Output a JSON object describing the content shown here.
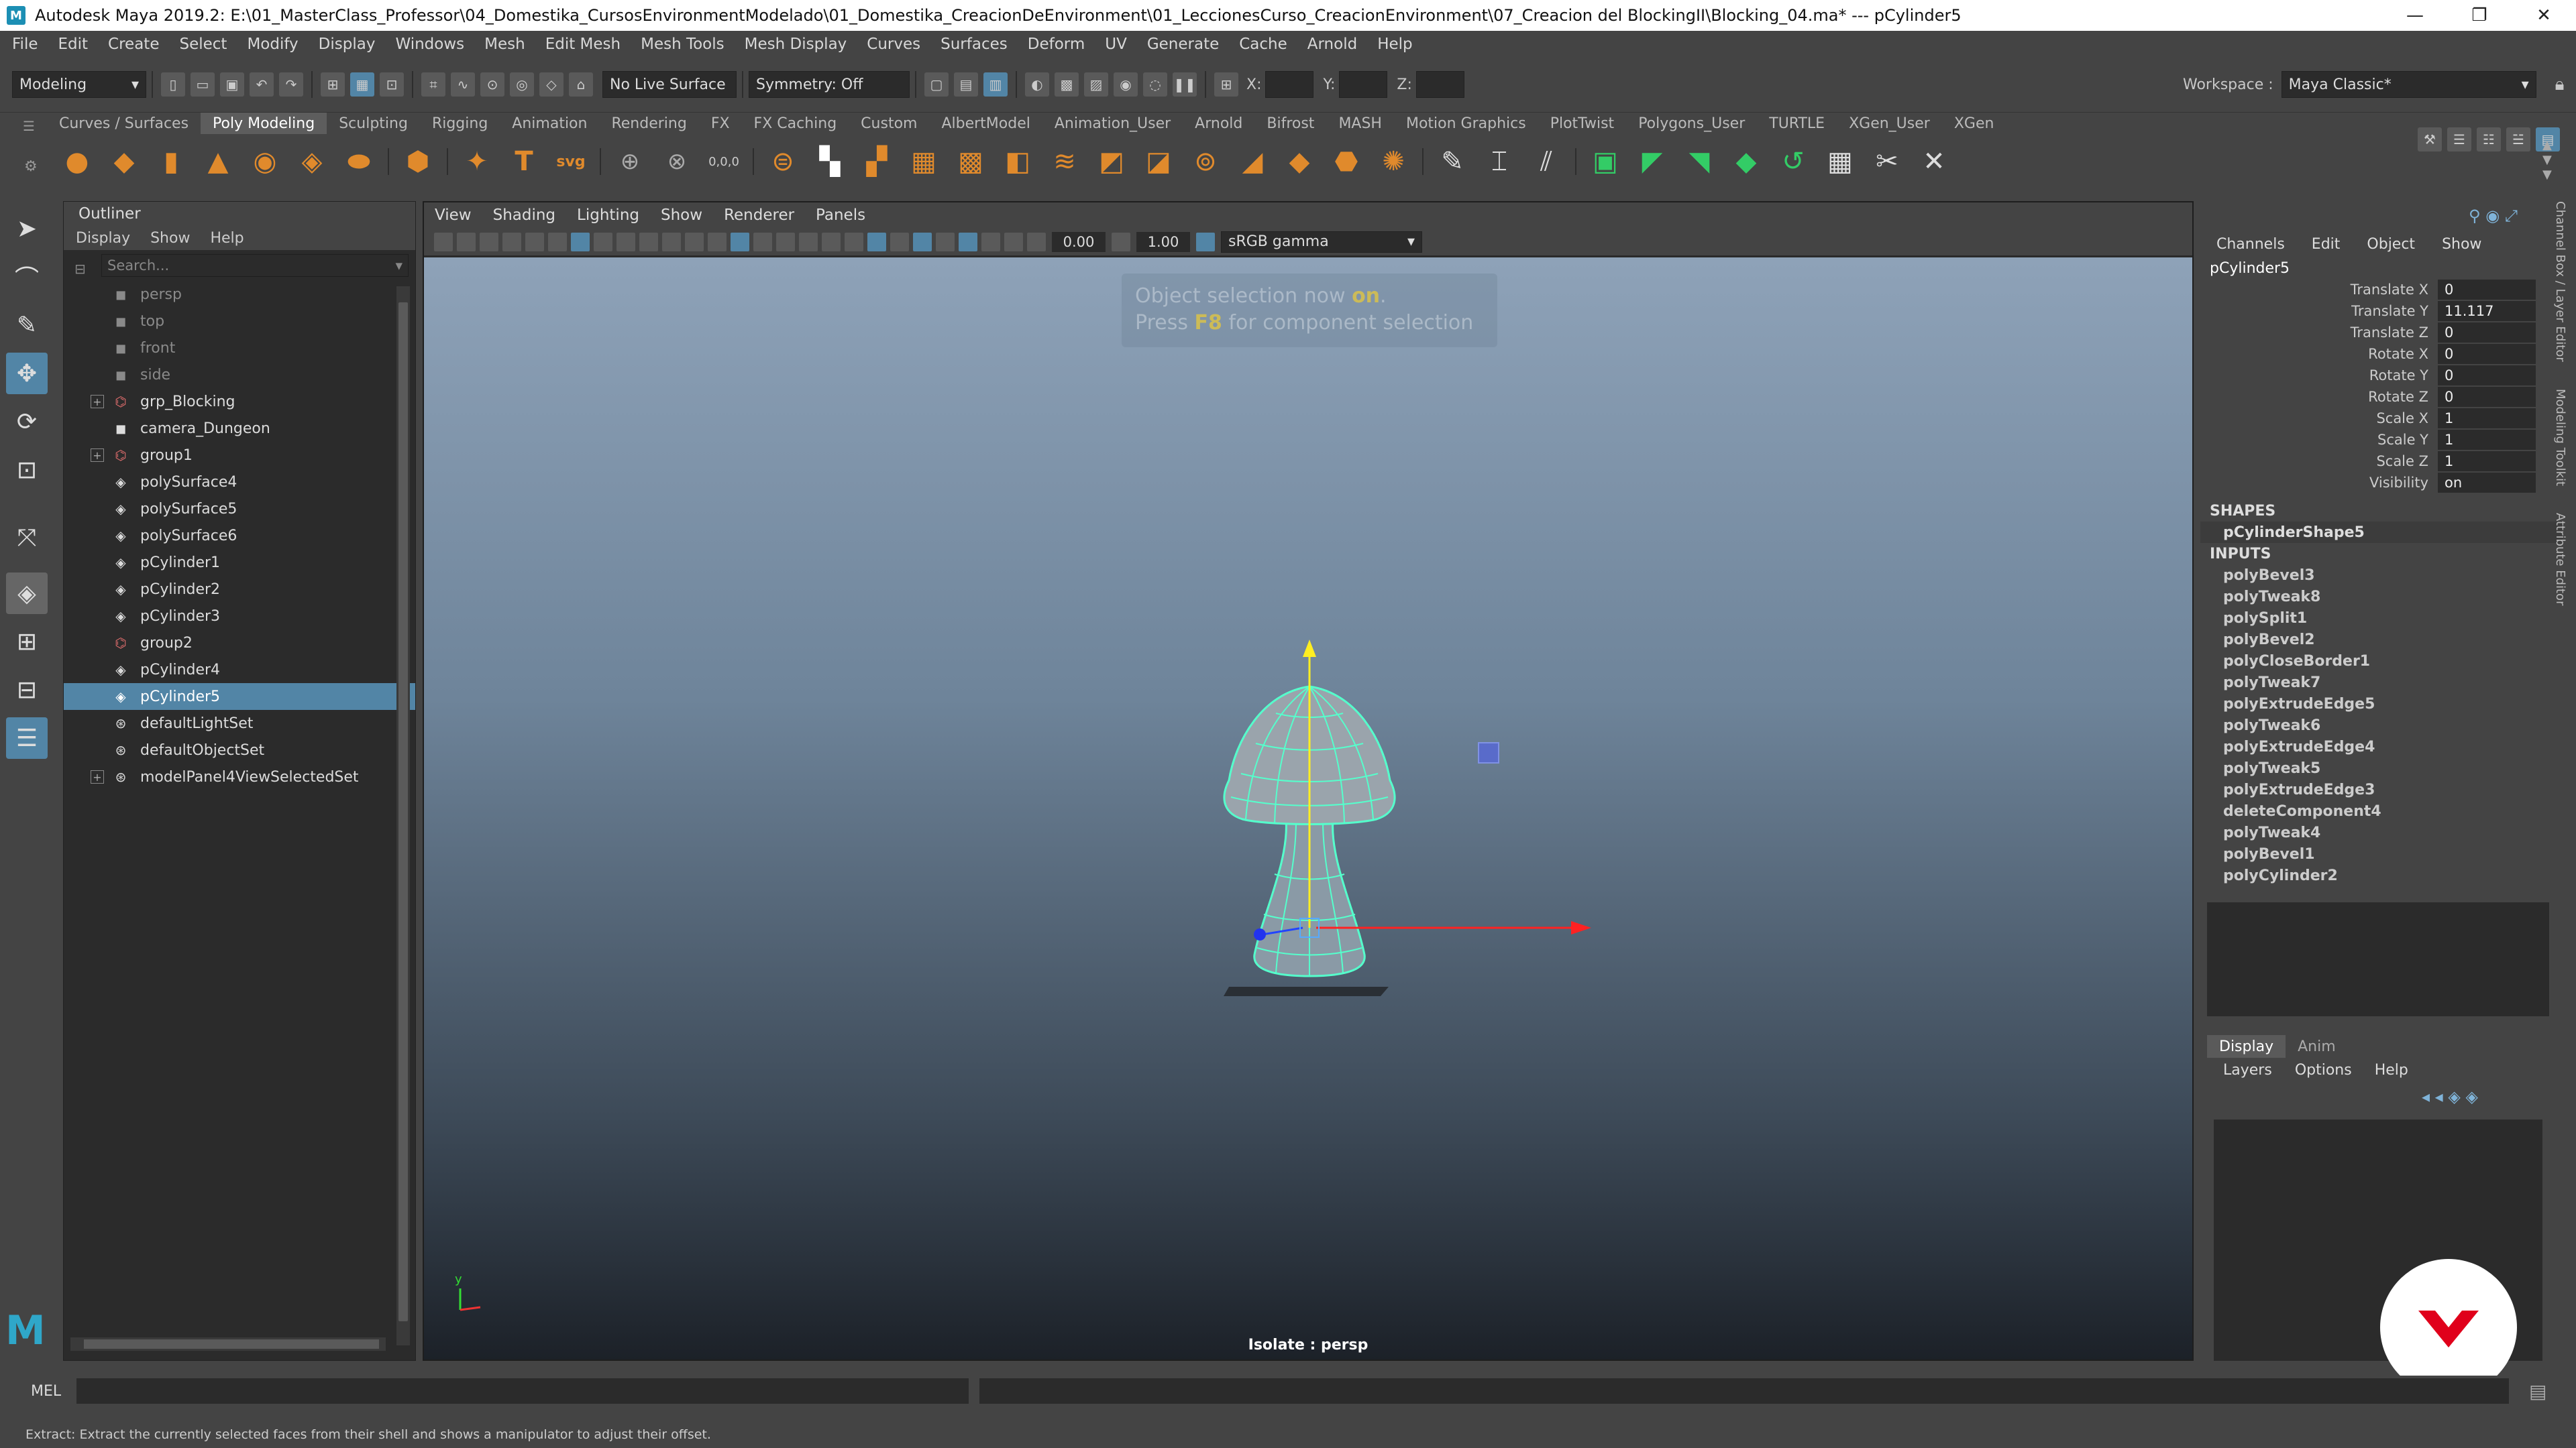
{
  "window": {
    "title": "Autodesk Maya 2019.2: E:\\01_MasterClass_Professor\\04_Domestika_CursosEnvironmentModelado\\01_Domestika_CreacionDeEnvironment\\01_LeccionesCurso_CreacionEnvironment\\07_Creacion del BlockingII\\Blocking_04.ma*   ---   pCylinder5",
    "minimize": "—",
    "maximize": "❐",
    "close": "✕"
  },
  "menubar": [
    "File",
    "Edit",
    "Create",
    "Select",
    "Modify",
    "Display",
    "Windows",
    "Mesh",
    "Edit Mesh",
    "Mesh Tools",
    "Mesh Display",
    "Curves",
    "Surfaces",
    "Deform",
    "UV",
    "Generate",
    "Cache",
    "Arnold",
    "Help"
  ],
  "statusline": {
    "menuset": "Modeling",
    "live_surface": "No Live Surface",
    "symmetry": "Symmetry: Off",
    "x_label": "X:",
    "y_label": "Y:",
    "z_label": "Z:",
    "workspace_label": "Workspace :",
    "workspace_value": "Maya Classic*"
  },
  "shelf": {
    "tabs": [
      "Curves / Surfaces",
      "Poly Modeling",
      "Sculpting",
      "Rigging",
      "Animation",
      "Rendering",
      "FX",
      "FX Caching",
      "Custom",
      "AlbertModel",
      "Animation_User",
      "Arnold",
      "Bifrost",
      "MASH",
      "Motion Graphics",
      "PlotTwist",
      "Polygons_User",
      "TURTLE",
      "XGen_User",
      "XGen"
    ],
    "active": "Poly Modeling",
    "text_icon": "T",
    "svg_icon": "svg",
    "coord_icon": "0,0,0"
  },
  "outliner": {
    "title": "Outliner",
    "menu": [
      "Display",
      "Show",
      "Help"
    ],
    "search_placeholder": "Search...",
    "items": [
      {
        "label": "persp",
        "icon": "camera-icon",
        "dim": true
      },
      {
        "label": "top",
        "icon": "camera-icon",
        "dim": true
      },
      {
        "label": "front",
        "icon": "camera-icon",
        "dim": true
      },
      {
        "label": "side",
        "icon": "camera-icon",
        "dim": true
      },
      {
        "label": "grp_Blocking",
        "icon": "group-icon",
        "expand": true
      },
      {
        "label": "camera_Dungeon",
        "icon": "camera-icon"
      },
      {
        "label": "group1",
        "icon": "group-icon",
        "expand": true
      },
      {
        "label": "polySurface4",
        "icon": "mesh-icon"
      },
      {
        "label": "polySurface5",
        "icon": "mesh-icon"
      },
      {
        "label": "polySurface6",
        "icon": "mesh-icon"
      },
      {
        "label": "pCylinder1",
        "icon": "mesh-icon"
      },
      {
        "label": "pCylinder2",
        "icon": "mesh-icon"
      },
      {
        "label": "pCylinder3",
        "icon": "mesh-icon"
      },
      {
        "label": "group2",
        "icon": "group-icon"
      },
      {
        "label": "pCylinder4",
        "icon": "mesh-icon"
      },
      {
        "label": "pCylinder5",
        "icon": "mesh-icon",
        "selected": true
      },
      {
        "label": "defaultLightSet",
        "icon": "set-icon"
      },
      {
        "label": "defaultObjectSet",
        "icon": "set-icon"
      },
      {
        "label": "modelPanel4ViewSelectedSet",
        "icon": "set-icon",
        "expand": true
      }
    ]
  },
  "viewport": {
    "menu": [
      "View",
      "Shading",
      "Lighting",
      "Show",
      "Renderer",
      "Panels"
    ],
    "exposure": "0.00",
    "gamma": "1.00",
    "colorspace": "sRGB gamma",
    "hud_line1_a": "Object selection now ",
    "hud_line1_b": "on",
    "hud_line1_c": ".",
    "hud_line2_a": "Press ",
    "hud_line2_b": "F8",
    "hud_line2_c": " for component selection",
    "isolate_label": "Isolate : persp",
    "axis_y": "y",
    "axis_x": "x"
  },
  "channelbox": {
    "menu": [
      "Channels",
      "Edit",
      "Object",
      "Show"
    ],
    "node": "pCylinder5",
    "attributes": [
      {
        "name": "Translate X",
        "value": "0"
      },
      {
        "name": "Translate Y",
        "value": "11.117"
      },
      {
        "name": "Translate Z",
        "value": "0"
      },
      {
        "name": "Rotate X",
        "value": "0"
      },
      {
        "name": "Rotate Y",
        "value": "0"
      },
      {
        "name": "Rotate Z",
        "value": "0"
      },
      {
        "name": "Scale X",
        "value": "1"
      },
      {
        "name": "Scale Y",
        "value": "1"
      },
      {
        "name": "Scale Z",
        "value": "1"
      },
      {
        "name": "Visibility",
        "value": "on"
      }
    ],
    "shapes_header": "SHAPES",
    "shapes": [
      "pCylinderShape5"
    ],
    "inputs_header": "INPUTS",
    "inputs": [
      "polyBevel3",
      "polyTweak8",
      "polySplit1",
      "polyBevel2",
      "polyCloseBorder1",
      "polyTweak7",
      "polyExtrudeEdge5",
      "polyTweak6",
      "polyExtrudeEdge4",
      "polyTweak5",
      "polyExtrudeEdge3",
      "deleteComponent4",
      "polyTweak4",
      "polyBevel1",
      "polyCylinder2"
    ]
  },
  "side_tabs": [
    "Channel Box / Layer Editor",
    "Modeling Toolkit",
    "Attribute Editor"
  ],
  "layer_editor": {
    "tabs": [
      "Display",
      "Anim"
    ],
    "active": "Display",
    "menu": [
      "Layers",
      "Options",
      "Help"
    ]
  },
  "command_line": {
    "label": "MEL"
  },
  "help_line": "Extract: Extract the currently selected faces from their shell and shows a manipulator to adjust their offset.",
  "colors": {
    "selection": "#5285a6",
    "wireframe": "#55ffcc",
    "brand_logo": "#e0001b"
  }
}
